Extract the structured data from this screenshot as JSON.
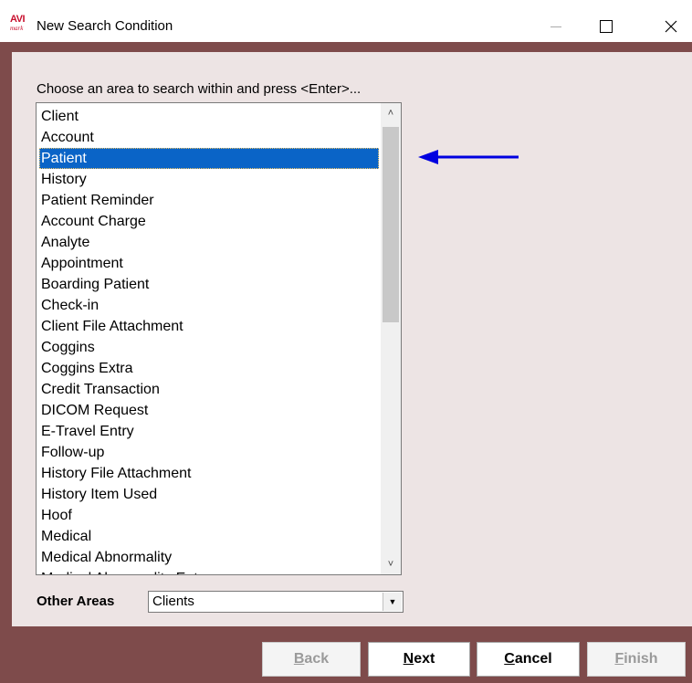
{
  "window": {
    "app_logo_text": "AVI",
    "app_logo_sub": "mark",
    "title": "New Search Condition",
    "minimize_icon": "minimize-icon",
    "maximize_icon": "maximize-icon",
    "close_icon": "close-icon"
  },
  "prompt": "Choose an area to search within and press <Enter>...",
  "list": {
    "items": [
      "Client",
      "Account",
      "Patient",
      "History",
      "Patient Reminder",
      "Account Charge",
      "Analyte",
      "Appointment",
      "Boarding Patient",
      "Check-in",
      "Client File Attachment",
      "Coggins",
      "Coggins Extra",
      "Credit Transaction",
      "DICOM Request",
      "E-Travel Entry",
      "Follow-up",
      "History File Attachment",
      "History Item Used",
      "Hoof",
      "Medical",
      "Medical Abnormality",
      "Medical Abnormality Entry"
    ],
    "selected_item": "Patient",
    "scroll_position": 0.0
  },
  "other_areas": {
    "label": "Other Areas",
    "value": "Clients"
  },
  "buttons": {
    "back": {
      "pre": "",
      "key": "B",
      "post": "ack",
      "enabled": false
    },
    "next": {
      "pre": "",
      "key": "N",
      "post": "ext",
      "enabled": true
    },
    "cancel": {
      "pre": "",
      "key": "C",
      "post": "ancel",
      "enabled": true
    },
    "finish": {
      "pre": "",
      "key": "F",
      "post": "inish",
      "enabled": false
    }
  },
  "colors": {
    "frame": "#7e4b4b",
    "panel": "#ede4e4",
    "selection": "#0a64c7",
    "annotation_arrow": "#0000e0"
  }
}
